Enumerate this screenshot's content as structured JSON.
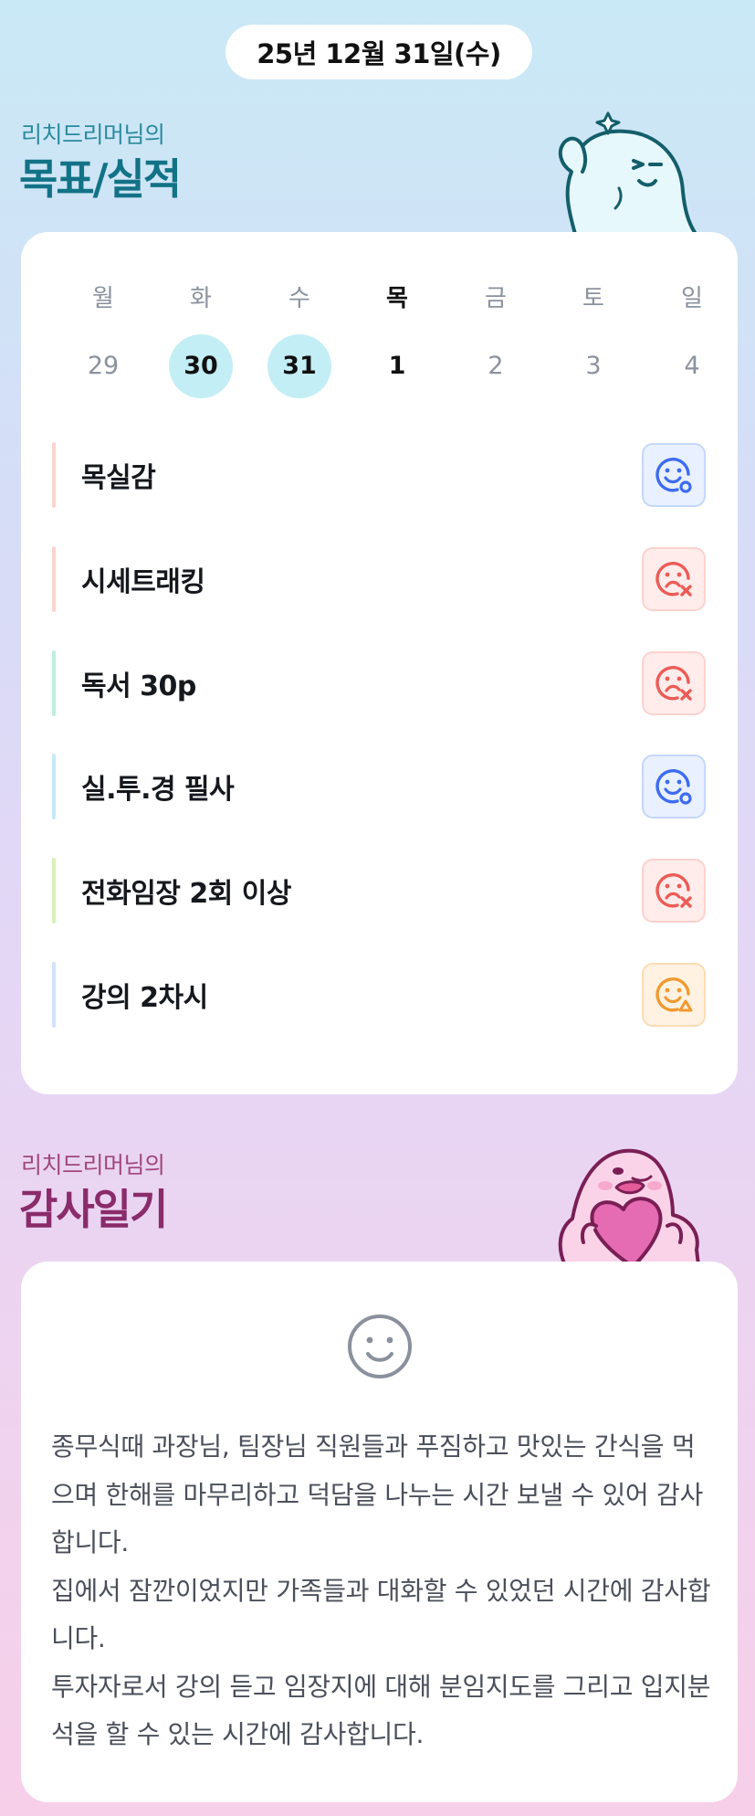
{
  "header": {
    "date": "25년 12월 31일(수)"
  },
  "goals_section": {
    "subtitle": "리치드리머님의",
    "title": "목표/실적",
    "week": [
      {
        "dow": "월",
        "num": "29",
        "state": "normal"
      },
      {
        "dow": "화",
        "num": "30",
        "state": "done"
      },
      {
        "dow": "수",
        "num": "31",
        "state": "done"
      },
      {
        "dow": "목",
        "num": "1",
        "state": "today"
      },
      {
        "dow": "금",
        "num": "2",
        "state": "normal"
      },
      {
        "dow": "토",
        "num": "3",
        "state": "normal"
      },
      {
        "dow": "일",
        "num": "4",
        "state": "normal"
      }
    ],
    "goals": [
      {
        "label": "목실감",
        "status": "achieved",
        "bar_color": "#fbd4d0",
        "icon": "smile-o-icon"
      },
      {
        "label": "시세트래킹",
        "status": "failed",
        "bar_color": "#fbd4d0",
        "icon": "frown-x-icon"
      },
      {
        "label": "독서 30p",
        "status": "failed",
        "bar_color": "#bfeedd",
        "icon": "frown-x-icon"
      },
      {
        "label": "실.투.경 필사",
        "status": "achieved",
        "bar_color": "#c6e9f6",
        "icon": "smile-o-icon"
      },
      {
        "label": "전화임장 2회 이상",
        "status": "failed",
        "bar_color": "#d9f0b8",
        "icon": "frown-x-icon"
      },
      {
        "label": "강의 2차시",
        "status": "partial",
        "bar_color": "#d4e2fa",
        "icon": "smile-triangle-icon"
      }
    ]
  },
  "gratitude_section": {
    "subtitle": "리치드리머님의",
    "title": "감사일기",
    "mood_icon": "smile-face-icon",
    "entries": [
      "종무식때 과장님, 팀장님 직원들과 푸짐하고 맛있는 간식을 먹으며 한해를 마무리하고 덕담을 나누는 시간 보낼 수 있어 감사합니다.",
      "집에서 잠깐이었지만 가족들과 대화할 수 있었던 시간에 감사합니다.",
      "투자자로서 강의 듣고 임장지에 대해 분임지도를 그리고 입지분석을 할 수 있는 시간에 감사합니다."
    ]
  },
  "colors": {
    "achieved": "#3d6cf0",
    "failed": "#ec5b55",
    "partial": "#f09a30",
    "goals_title": "#127286",
    "gratitude_title": "#8a2b6a",
    "done_day": "#c4eef5"
  }
}
